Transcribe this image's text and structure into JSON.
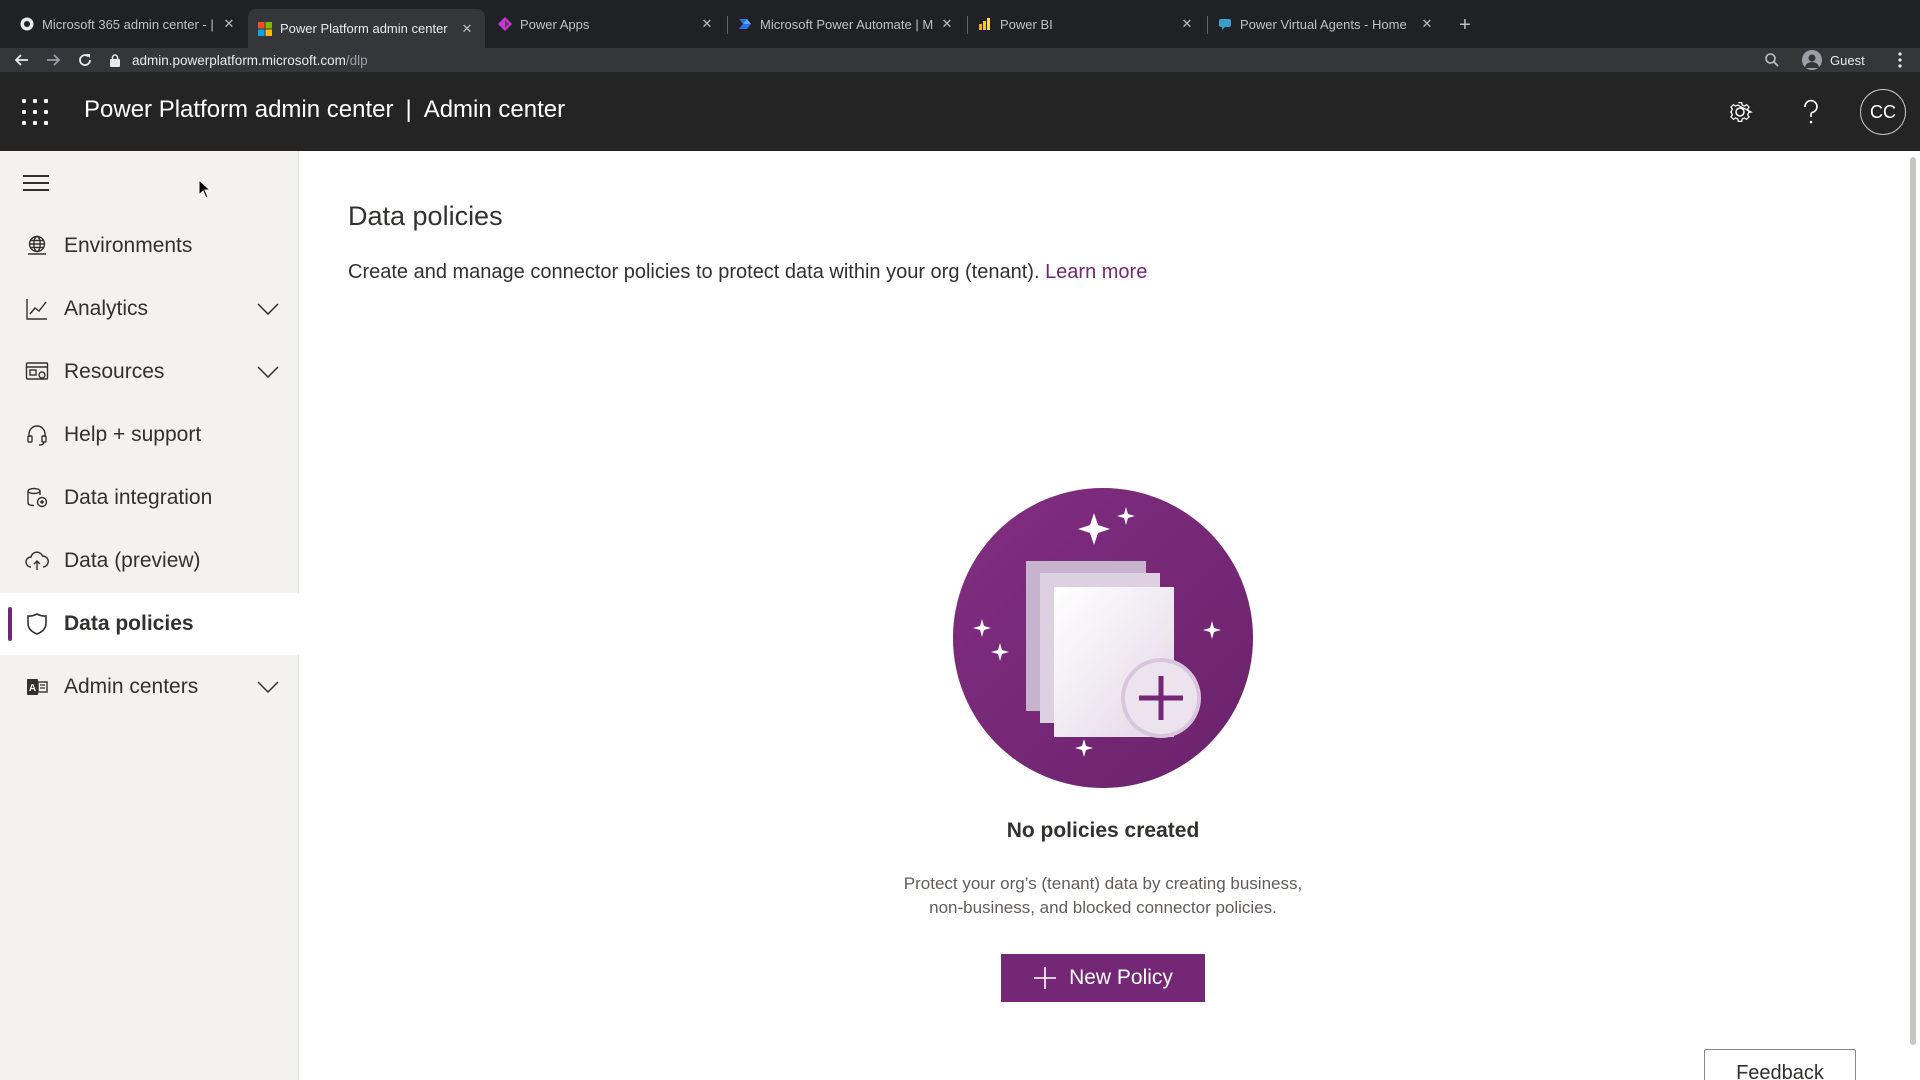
{
  "browser": {
    "tabs": [
      {
        "title": "Microsoft 365 admin center - |",
        "icon": "m365-icon",
        "active": false
      },
      {
        "title": "Power Platform admin center",
        "icon": "microsoft-logo-icon",
        "active": true
      },
      {
        "title": "Power Apps",
        "icon": "power-apps-icon",
        "active": false
      },
      {
        "title": "Microsoft Power Automate | M",
        "icon": "power-automate-icon",
        "active": false
      },
      {
        "title": "Power BI",
        "icon": "power-bi-icon",
        "active": false
      },
      {
        "title": "Power Virtual Agents - Home",
        "icon": "power-virtual-agents-icon",
        "active": false
      }
    ],
    "url": {
      "host": "admin.powerplatform.microsoft.com",
      "path": "/dlp"
    },
    "profile_label": "Guest"
  },
  "header": {
    "product": "Power Platform admin center",
    "separator": "|",
    "section": "Admin center",
    "avatar_initials": "CC"
  },
  "sidebar": {
    "items": [
      {
        "label": "Environments",
        "icon": "globe-icon",
        "expandable": false,
        "selected": false
      },
      {
        "label": "Analytics",
        "icon": "chart-line-icon",
        "expandable": true,
        "selected": false
      },
      {
        "label": "Resources",
        "icon": "resources-icon",
        "expandable": true,
        "selected": false
      },
      {
        "label": "Help + support",
        "icon": "headset-icon",
        "expandable": false,
        "selected": false
      },
      {
        "label": "Data integration",
        "icon": "data-integration-icon",
        "expandable": false,
        "selected": false
      },
      {
        "label": "Data (preview)",
        "icon": "cloud-data-icon",
        "expandable": false,
        "selected": false
      },
      {
        "label": "Data policies",
        "icon": "shield-icon",
        "expandable": false,
        "selected": true
      },
      {
        "label": "Admin centers",
        "icon": "admin-centers-icon",
        "expandable": true,
        "selected": false
      }
    ]
  },
  "main": {
    "title": "Data policies",
    "description": "Create and manage connector policies to protect data within your org (tenant). ",
    "learn_more": "Learn more",
    "empty_state": {
      "title": "No policies created",
      "line1": "Protect your org’s (tenant) data by creating business,",
      "line2": "non-business, and blocked connector policies."
    },
    "new_policy_label": "New Policy",
    "feedback_label": "Feedback"
  },
  "colors": {
    "brand": "#742774",
    "header_bg": "#242424",
    "sidebar_bg": "#f3f2f1"
  }
}
